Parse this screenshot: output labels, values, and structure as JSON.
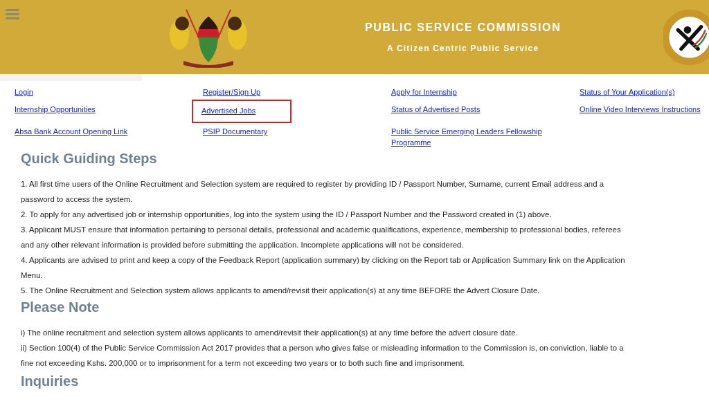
{
  "header": {
    "title": "PUBLIC SERVICE COMMISSION",
    "subtitle": "A Citizen Centric Public Service"
  },
  "links": [
    {
      "label": "Login",
      "highlighted": false
    },
    {
      "label": "Register/Sign Up",
      "highlighted": false
    },
    {
      "label": "Apply for Internship",
      "highlighted": false
    },
    {
      "label": "Status of Your Application(s)",
      "highlighted": false
    },
    {
      "label": "Internship Opportunities",
      "highlighted": false
    },
    {
      "label": "Advertised Jobs",
      "highlighted": true
    },
    {
      "label": "Status of Advertised Posts",
      "highlighted": false
    },
    {
      "label": "Online Video Interviews Instructions",
      "highlighted": false
    },
    {
      "label": "Absa Bank Account Opening Link",
      "highlighted": false
    },
    {
      "label": "PSIP Documentary",
      "highlighted": false
    },
    {
      "label": "Public Service Emerging Leaders Fellowship Programme",
      "highlighted": false
    }
  ],
  "sections": [
    {
      "heading": "Quick Guiding Steps",
      "paragraphs": [
        "1. All first time users of the Online Recruitment and Selection system are required to register by providing ID / Passport Number, Surname, current Email address and a password to access the system.",
        "2. To apply for any advertised job or internship opportunities, log into the system using the ID / Passport Number and the Password created in (1) above.",
        "3. Applicant MUST ensure that information pertaining to personal details, professional and academic qualifications, experience, membership to professional bodies, referees and any other relevant information is provided before submitting the application. Incomplete applications will not be considered.",
        "4. Applicants are advised to print and keep a copy of the Feedback Report (application summary) by clicking on the Report tab or Application Summary link on the Application Menu.",
        "5. The Online Recruitment and Selection system allows applicants to amend/revisit their application(s) at any time BEFORE the Advert Closure Date."
      ]
    },
    {
      "heading": "Please Note",
      "paragraphs": [
        "i) The online recruitment and selection system allows applicants to amend/revisit their application(s) at any time before the advert closure date.",
        "ii) Section 100(4) of the Public Service Commission Act 2017 provides that a person who gives false or misleading information to the Commission is, on conviction, liable to a fine not exceeding Kshs. 200,000 or to imprisonment for a term not exceeding two years or to both such fine and imprisonment."
      ]
    },
    {
      "heading": "Inquiries"
    }
  ]
}
